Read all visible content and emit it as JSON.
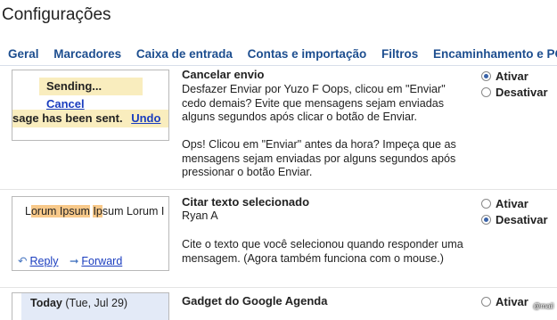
{
  "page_title": "Configurações",
  "tabs": [
    "Geral",
    "Marcadores",
    "Caixa de entrada",
    "Contas e importação",
    "Filtros",
    "Encaminhamento e PO"
  ],
  "features": [
    {
      "title": "Cancelar envio",
      "text1": "Desfazer Enviar por Yuzo F Oops, clicou em \"Enviar\" cedo demais? Evite que mensagens sejam enviadas alguns segundos após clicar o botão de Enviar.",
      "text2": "Ops! Clicou em \"Enviar\" antes da hora? Impeça que as mensagens sejam enviadas por alguns segundos após pressionar o botão Enviar.",
      "opt_on": "Ativar",
      "opt_off": "Desativar",
      "selected": "on",
      "preview": {
        "sending": "Sending...",
        "cancel": "Cancel",
        "sent": "sage has been sent.",
        "undo": "Undo"
      }
    },
    {
      "title": "Citar texto selecionado",
      "author": "Ryan A",
      "text1": "Cite o texto que você selecionou quando responder uma mensagem. (Agora também funciona com o mouse.)",
      "opt_on": "Ativar",
      "opt_off": "Desativar",
      "selected": "off",
      "preview": {
        "text_pre": "L",
        "text_hl1": "orum Ipsum",
        "text_mid": " ",
        "text_hl2": "Ip",
        "text_post": "sum Lorum I",
        "reply": "Reply",
        "forward": "Forward"
      }
    },
    {
      "title": "Gadget do Google Agenda",
      "opt_on": "Ativar",
      "preview": {
        "today": "Today",
        "date": "(Tue, Jul 29)"
      }
    }
  ],
  "watermark": "@mail"
}
